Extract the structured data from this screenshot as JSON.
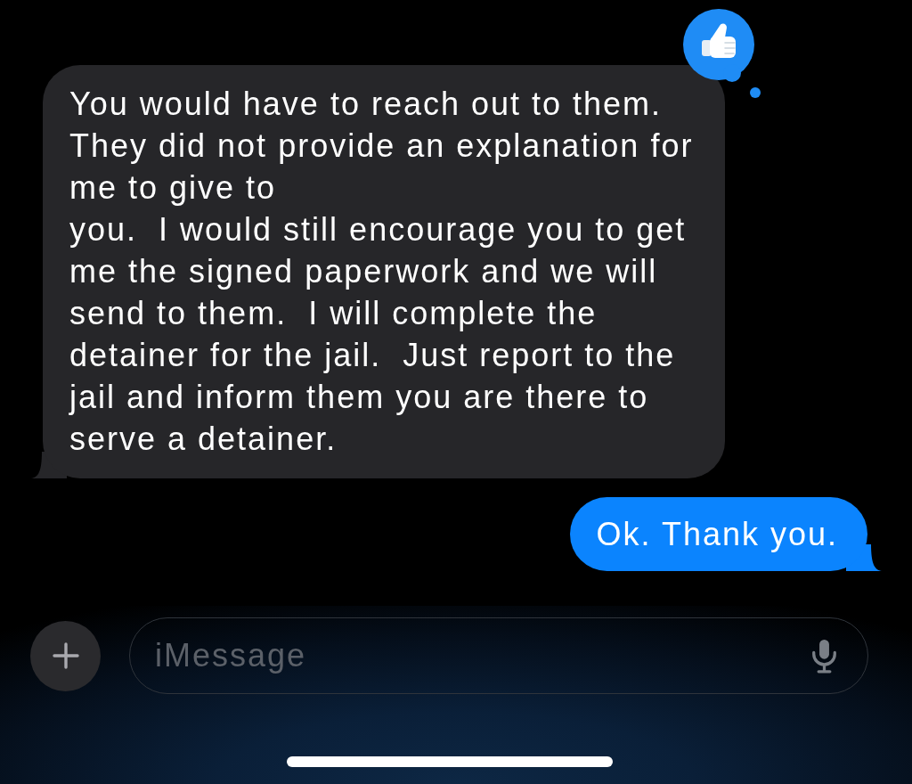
{
  "messages": [
    {
      "kind": "received",
      "text": "You would have to reach out to them.  They did not provide an explanation for me to give to\nyou.  I would still encourage you to get me the signed paperwork and we will send to them.  I will complete the detainer for the jail.  Just report to the jail and inform them you are there to serve a detainer.",
      "tapback": {
        "kind": "thumbs_up"
      }
    },
    {
      "kind": "sent",
      "text": "Ok. Thank you."
    }
  ],
  "composer": {
    "placeholder": "iMessage"
  }
}
